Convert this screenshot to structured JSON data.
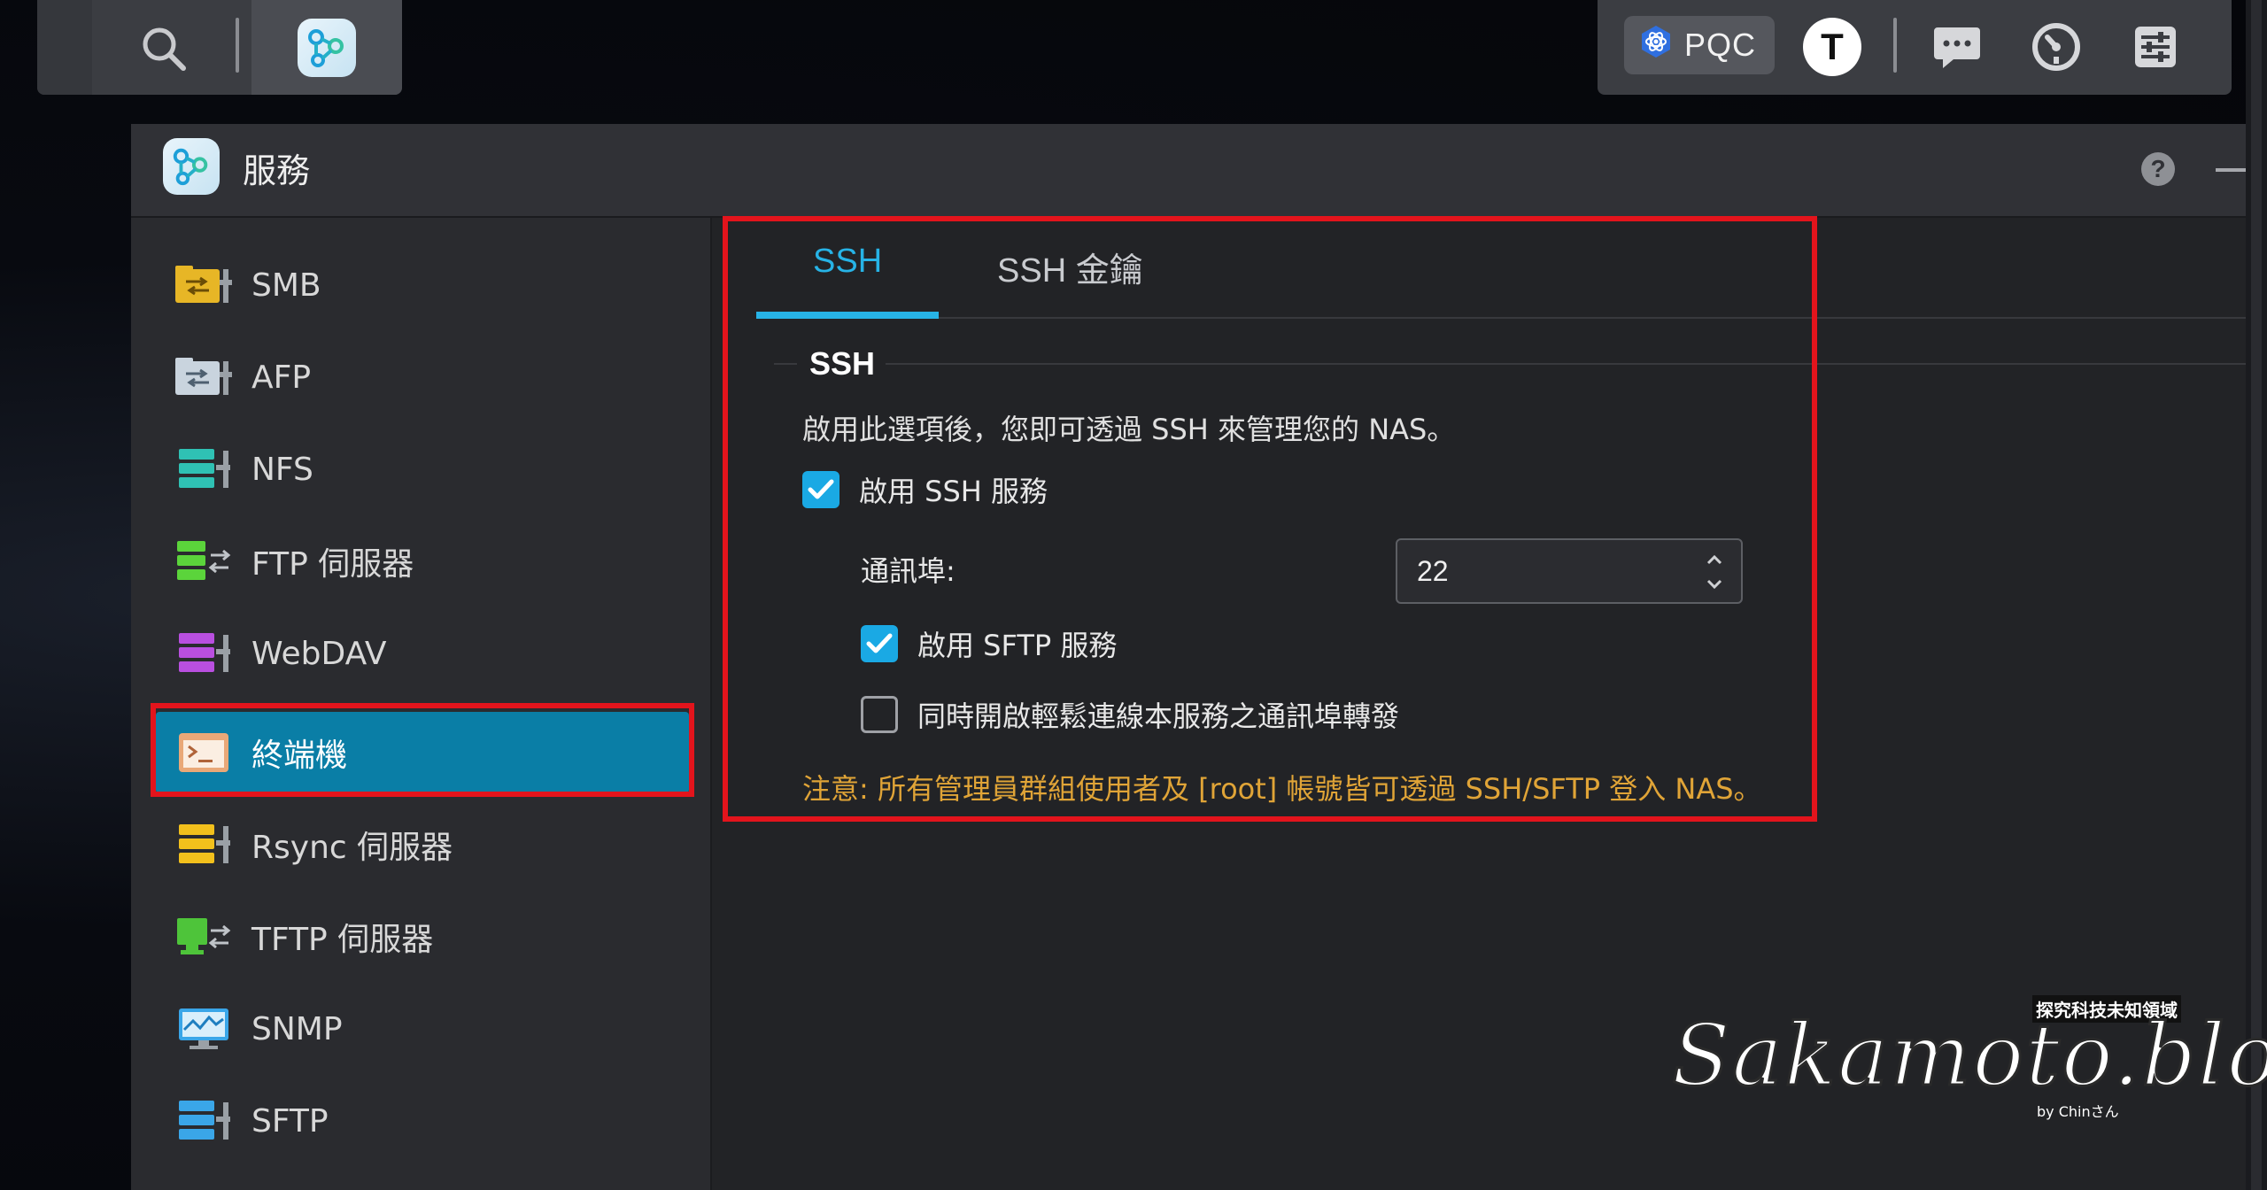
{
  "taskbar": {
    "pqc_label": "PQC",
    "avatar_letter": "T"
  },
  "window": {
    "title": "服務"
  },
  "sidebar": {
    "items": [
      {
        "label": "SMB",
        "icon": "smb-folder-icon",
        "color": "#e7b626"
      },
      {
        "label": "AFP",
        "icon": "afp-folder-icon",
        "color": "#c9d4de"
      },
      {
        "label": "NFS",
        "icon": "nfs-server-icon",
        "color": "#2fc1b4"
      },
      {
        "label": "FTP 伺服器",
        "icon": "ftp-server-icon",
        "color": "#5bd43b"
      },
      {
        "label": "WebDAV",
        "icon": "webdav-server-icon",
        "color": "#b94fe0"
      },
      {
        "label": "終端機",
        "icon": "terminal-icon",
        "color": "#e9a878"
      },
      {
        "label": "Rsync 伺服器",
        "icon": "rsync-server-icon",
        "color": "#f2c01c"
      },
      {
        "label": "TFTP 伺服器",
        "icon": "tftp-server-icon",
        "color": "#4ec43a"
      },
      {
        "label": "SNMP",
        "icon": "snmp-monitor-icon",
        "color": "#3aa6e8"
      },
      {
        "label": "SFTP",
        "icon": "sftp-server-icon",
        "color": "#3aa6e8"
      }
    ],
    "active_index": 5
  },
  "tabs": {
    "ssh": "SSH",
    "ssh_keys": "SSH 金鑰"
  },
  "ssh_section": {
    "title": "SSH",
    "description": "啟用此選項後，您即可透過 SSH 來管理您的 NAS。",
    "enable_ssh_label": "啟用 SSH 服務",
    "enable_ssh_checked": true,
    "port_label": "通訊埠:",
    "port_value": "22",
    "enable_sftp_label": "啟用 SFTP 服務",
    "enable_sftp_checked": true,
    "port_forward_label": "同時開啟輕鬆連線本服務之通訊埠轉發",
    "port_forward_checked": false,
    "note": "注意: 所有管理員群組使用者及 [root] 帳號皆可透過 SSH/SFTP 登入 NAS。"
  },
  "watermark": {
    "main": "Sakamoto.blog",
    "top": "探究科技未知領域",
    "by": "by Chinさん"
  },
  "colors": {
    "accent": "#27b3e6",
    "active_nav": "#0a7ea6",
    "highlight_outline": "#e3141c",
    "note": "#e0a437"
  }
}
